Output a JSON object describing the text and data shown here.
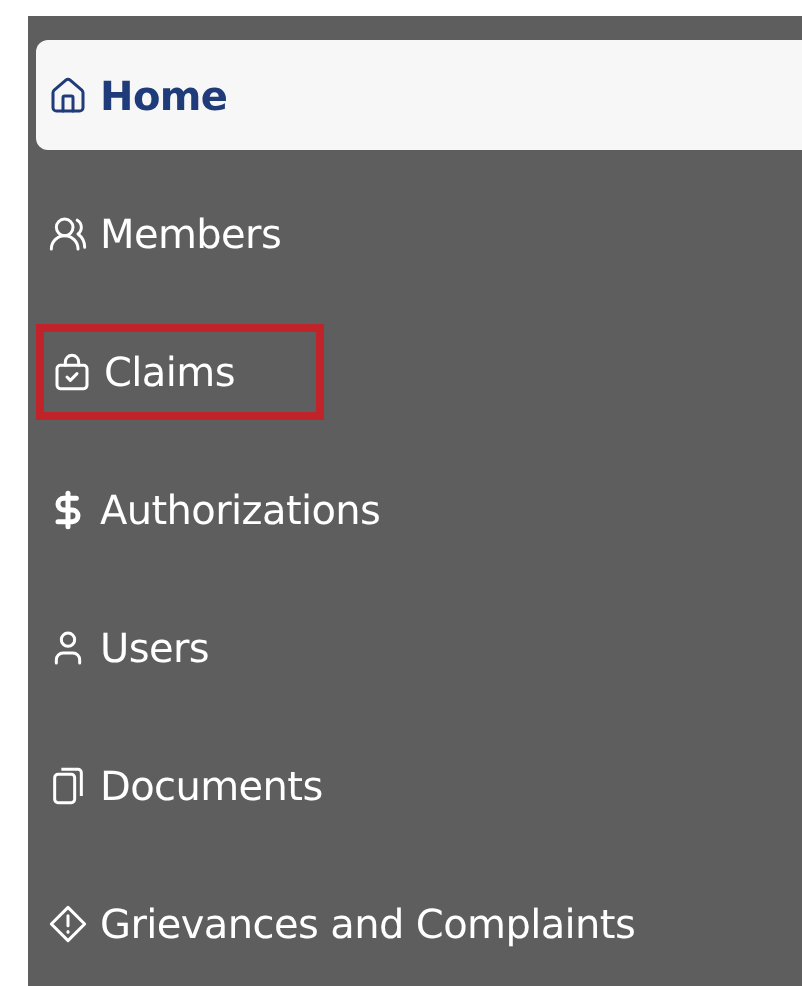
{
  "nav": {
    "items": [
      {
        "label": "Home",
        "selected": true,
        "highlighted": false
      },
      {
        "label": "Members",
        "selected": false,
        "highlighted": false
      },
      {
        "label": "Claims",
        "selected": false,
        "highlighted": true
      },
      {
        "label": "Authorizations",
        "selected": false,
        "highlighted": false
      },
      {
        "label": "Users",
        "selected": false,
        "highlighted": false
      },
      {
        "label": "Documents",
        "selected": false,
        "highlighted": false
      },
      {
        "label": "Grievances and Complaints",
        "selected": false,
        "highlighted": false
      }
    ]
  }
}
